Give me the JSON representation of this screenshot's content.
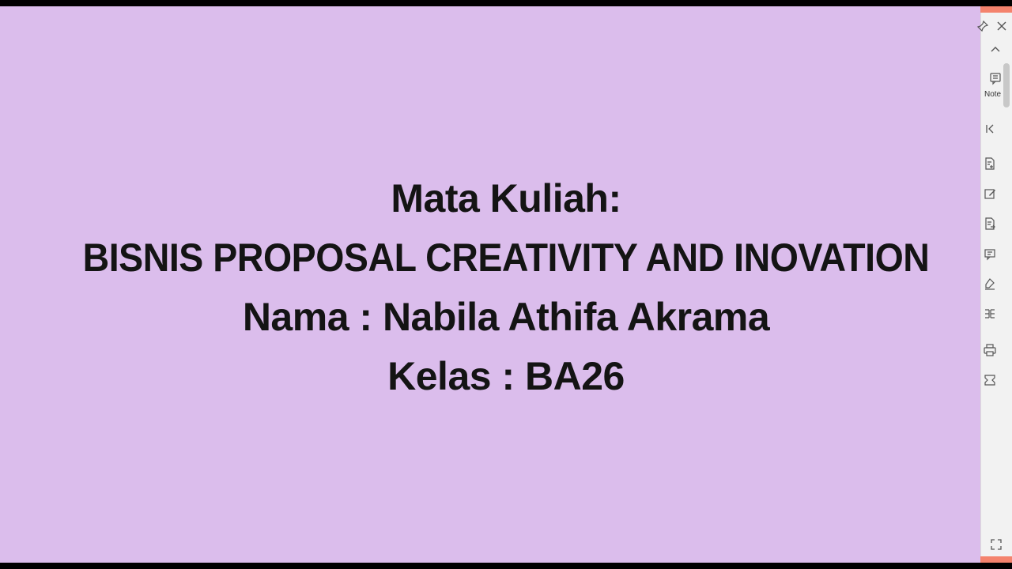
{
  "slide": {
    "background": "#dbbdec",
    "lines": [
      "Mata Kuliah:",
      "BISNIS PROPOSAL CREATIVITY AND INOVATION",
      "Nama : Nabila Athifa Akrama",
      "Kelas : BA26"
    ]
  },
  "side_panel": {
    "accent_color": "#f4836d",
    "note_label": "Note",
    "icons": [
      "pin-icon",
      "close-icon",
      "chevron-up-icon",
      "note-icon",
      "collapse-icon",
      "add-document-icon",
      "edit-icon",
      "document-export-icon",
      "comment-icon",
      "pen-icon",
      "columns-icon",
      "print-icon",
      "shape-icon",
      "fullscreen-icon"
    ]
  }
}
